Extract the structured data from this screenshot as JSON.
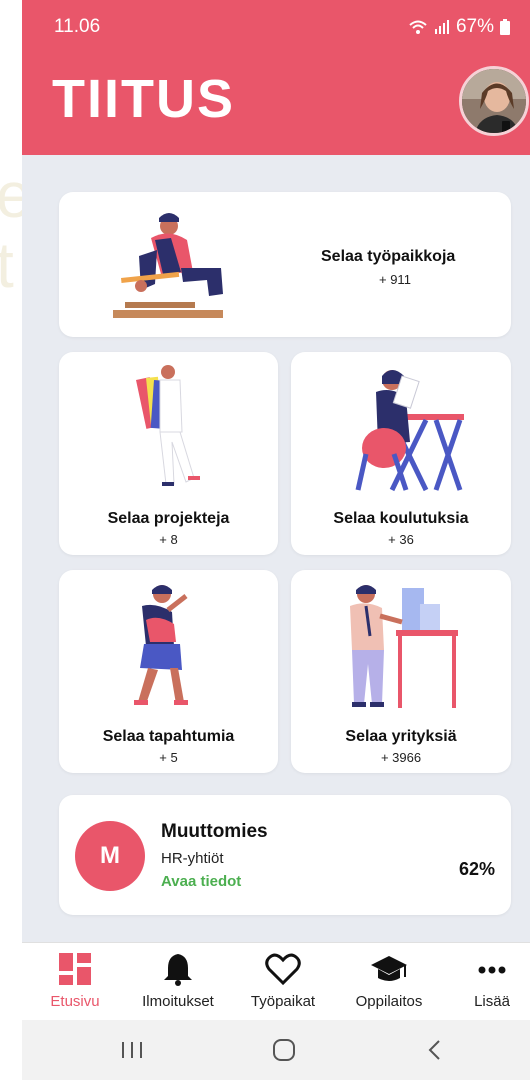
{
  "status_bar": {
    "time": "11.06",
    "battery": "67%"
  },
  "header": {
    "logo_text": "TIITUS"
  },
  "cards": {
    "jobs": {
      "title": "Selaa työpaikkoja",
      "count": "+ 911"
    },
    "projects": {
      "title": "Selaa projekteja",
      "count": "+ 8"
    },
    "education": {
      "title": "Selaa koulutuksia",
      "count": "+ 36"
    },
    "events": {
      "title": "Selaa tapahtumia",
      "count": "+ 5"
    },
    "companies": {
      "title": "Selaa yrityksiä",
      "count": "+ 3966"
    }
  },
  "company": {
    "initial": "M",
    "name": "Muuttomies",
    "category": "HR-yhtiöt",
    "link": "Avaa tiedot",
    "percent": "62%"
  },
  "nav": [
    {
      "label": "Etusivu",
      "icon": "home-grid-icon",
      "active": true
    },
    {
      "label": "Ilmoitukset",
      "icon": "bell-icon",
      "active": false
    },
    {
      "label": "Työpaikat",
      "icon": "heart-icon",
      "active": false
    },
    {
      "label": "Oppilaitos",
      "icon": "graduation-cap-icon",
      "active": false
    },
    {
      "label": "Lisää",
      "icon": "more-dots-icon",
      "active": false
    }
  ],
  "colors": {
    "accent": "#e9566a",
    "background": "#e8ebf1",
    "link_green": "#4caf50"
  }
}
